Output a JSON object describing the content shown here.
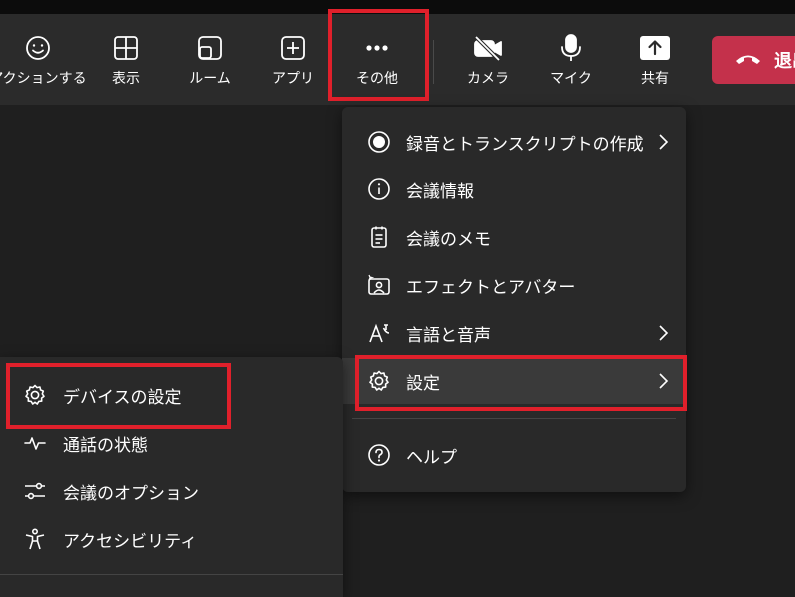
{
  "toolbar": {
    "items": [
      {
        "label": "アクションする",
        "icon": "smiley-icon"
      },
      {
        "label": "表示",
        "icon": "grid-icon"
      },
      {
        "label": "ルーム",
        "icon": "rooms-icon"
      },
      {
        "label": "アプリ",
        "icon": "add-app-icon"
      },
      {
        "label": "その他",
        "icon": "more-icon"
      },
      {
        "label": "カメラ",
        "icon": "camera-off-icon"
      },
      {
        "label": "マイク",
        "icon": "mic-icon"
      },
      {
        "label": "共有",
        "icon": "share-icon"
      }
    ],
    "leave_label": "退出",
    "colors": {
      "bar": "#2b2b2b",
      "leave": "#c4314b",
      "highlight": "#e0202b"
    }
  },
  "more_menu": {
    "items": [
      {
        "label": "録音とトランスクリプトの作成",
        "icon": "record-icon",
        "submenu": true
      },
      {
        "label": "会議情報",
        "icon": "info-icon",
        "submenu": false
      },
      {
        "label": "会議のメモ",
        "icon": "notes-icon",
        "submenu": false
      },
      {
        "label": "エフェクトとアバター",
        "icon": "effects-icon",
        "submenu": false
      },
      {
        "label": "言語と音声",
        "icon": "language-icon",
        "submenu": true
      },
      {
        "label": "設定",
        "icon": "gear-icon",
        "submenu": true
      },
      {
        "label": "ヘルプ",
        "icon": "help-icon",
        "submenu": false
      }
    ]
  },
  "settings_menu": {
    "items": [
      {
        "label": "デバイスの設定",
        "icon": "gear-icon"
      },
      {
        "label": "通話の状態",
        "icon": "pulse-icon"
      },
      {
        "label": "会議のオプション",
        "icon": "sliders-icon"
      },
      {
        "label": "アクセシビリティ",
        "icon": "accessibility-icon"
      }
    ]
  }
}
